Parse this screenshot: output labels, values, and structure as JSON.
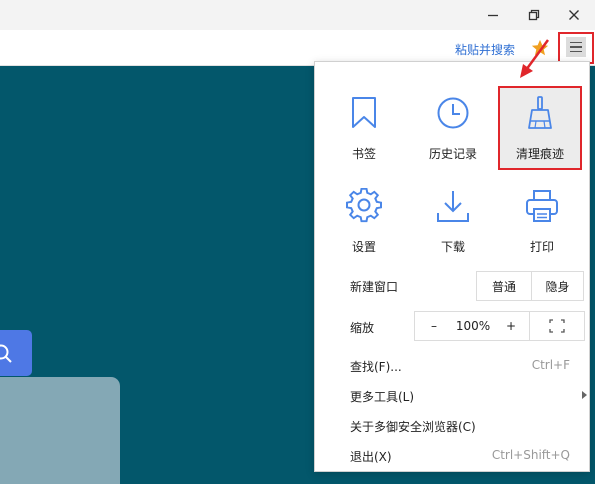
{
  "titlebar": {
    "buttons": [
      {
        "icon": "minimize-icon"
      },
      {
        "icon": "restore-icon"
      },
      {
        "icon": "close-icon"
      }
    ]
  },
  "toolbar": {
    "paste_search_label": "粘贴并搜索",
    "star_icon": "star-icon",
    "menu_icon": "hamburger-menu-icon",
    "star_color": "#f0a020"
  },
  "page": {
    "background_color": "#03576b",
    "search_button_color": "#4e78e5"
  },
  "menu": {
    "tiles": [
      {
        "icon": "bookmark-icon",
        "label": "书签"
      },
      {
        "icon": "history-clock-icon",
        "label": "历史记录"
      },
      {
        "icon": "broom-icon",
        "label": "清理痕迹"
      },
      {
        "icon": "gear-icon",
        "label": "设置"
      },
      {
        "icon": "download-icon",
        "label": "下载"
      },
      {
        "icon": "printer-icon",
        "label": "打印"
      }
    ],
    "new_window": {
      "label": "新建窗口",
      "normal": "普通",
      "incognito": "隐身"
    },
    "zoom": {
      "label": "缩放",
      "minus": "–",
      "value": "100%",
      "plus": "+"
    },
    "items": [
      {
        "label": "查找(F)...",
        "shortcut": "Ctrl+F"
      },
      {
        "label": "更多工具(L)",
        "shortcut": ""
      },
      {
        "label": "关于多御安全浏览器(C)",
        "shortcut": ""
      },
      {
        "label": "退出(X)",
        "shortcut": "Ctrl+Shift+Q"
      }
    ],
    "icon_color": "#4a86e8",
    "highlight_color": "#e0262b"
  }
}
